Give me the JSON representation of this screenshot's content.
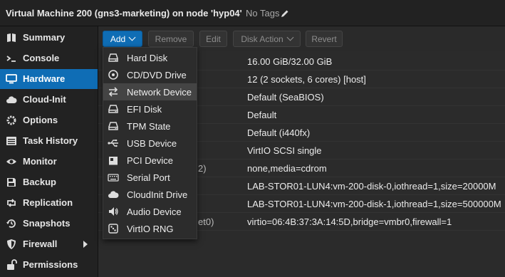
{
  "header": {
    "title": "Virtual Machine 200 (gns3-marketing) on node 'hyp04'",
    "tags_label": "No Tags"
  },
  "sidebar": {
    "items": [
      {
        "label": "Summary",
        "icon": "book-icon"
      },
      {
        "label": "Console",
        "icon": "terminal-icon"
      },
      {
        "label": "Hardware",
        "icon": "monitor-icon",
        "active": true
      },
      {
        "label": "Cloud-Init",
        "icon": "cloud-icon"
      },
      {
        "label": "Options",
        "icon": "gear-icon"
      },
      {
        "label": "Task History",
        "icon": "list-icon"
      },
      {
        "label": "Monitor",
        "icon": "eye-icon"
      },
      {
        "label": "Backup",
        "icon": "floppy-icon"
      },
      {
        "label": "Replication",
        "icon": "retweet-icon"
      },
      {
        "label": "Snapshots",
        "icon": "history-icon"
      },
      {
        "label": "Firewall",
        "icon": "shield-icon",
        "has_submenu": true
      },
      {
        "label": "Permissions",
        "icon": "unlock-icon"
      }
    ]
  },
  "toolbar": {
    "add": "Add",
    "remove": "Remove",
    "edit": "Edit",
    "disk_action": "Disk Action",
    "revert": "Revert"
  },
  "hardware_rows": [
    {
      "key": "",
      "value": "16.00 GiB/32.00 GiB"
    },
    {
      "key": "",
      "value": "12 (2 sockets, 6 cores) [host]"
    },
    {
      "key": "",
      "value": "Default (SeaBIOS)"
    },
    {
      "key": "",
      "value": "Default"
    },
    {
      "key": "",
      "value": "Default (i440fx)"
    },
    {
      "key": "",
      "value": "VirtIO SCSI single"
    },
    {
      "key": "(",
      "key_tail": "2)",
      "value": "none,media=cdrom"
    },
    {
      "key": "",
      "value": "LAB-STOR01-LUN4:vm-200-disk-0,iothread=1,size=20000M"
    },
    {
      "key": "",
      "value": "LAB-STOR01-LUN4:vm-200-disk-1,iothread=1,size=500000M"
    },
    {
      "key": "",
      "key_tail": "et0)",
      "value": "virtio=06:4B:37:3A:14:5D,bridge=vmbr0,firewall=1"
    }
  ],
  "add_menu": {
    "items": [
      {
        "label": "Hard Disk",
        "icon": "hdd-icon"
      },
      {
        "label": "CD/DVD Drive",
        "icon": "disc-icon"
      },
      {
        "label": "Network Device",
        "icon": "exchange-icon",
        "hover": true
      },
      {
        "label": "EFI Disk",
        "icon": "hdd-icon"
      },
      {
        "label": "TPM State",
        "icon": "hdd-icon"
      },
      {
        "label": "USB Device",
        "icon": "usb-icon"
      },
      {
        "label": "PCI Device",
        "icon": "pci-card-icon"
      },
      {
        "label": "Serial Port",
        "icon": "keyboard-icon"
      },
      {
        "label": "CloudInit Drive",
        "icon": "cloud-icon"
      },
      {
        "label": "Audio Device",
        "icon": "volume-icon"
      },
      {
        "label": "VirtIO RNG",
        "icon": "dice-icon"
      }
    ]
  }
}
